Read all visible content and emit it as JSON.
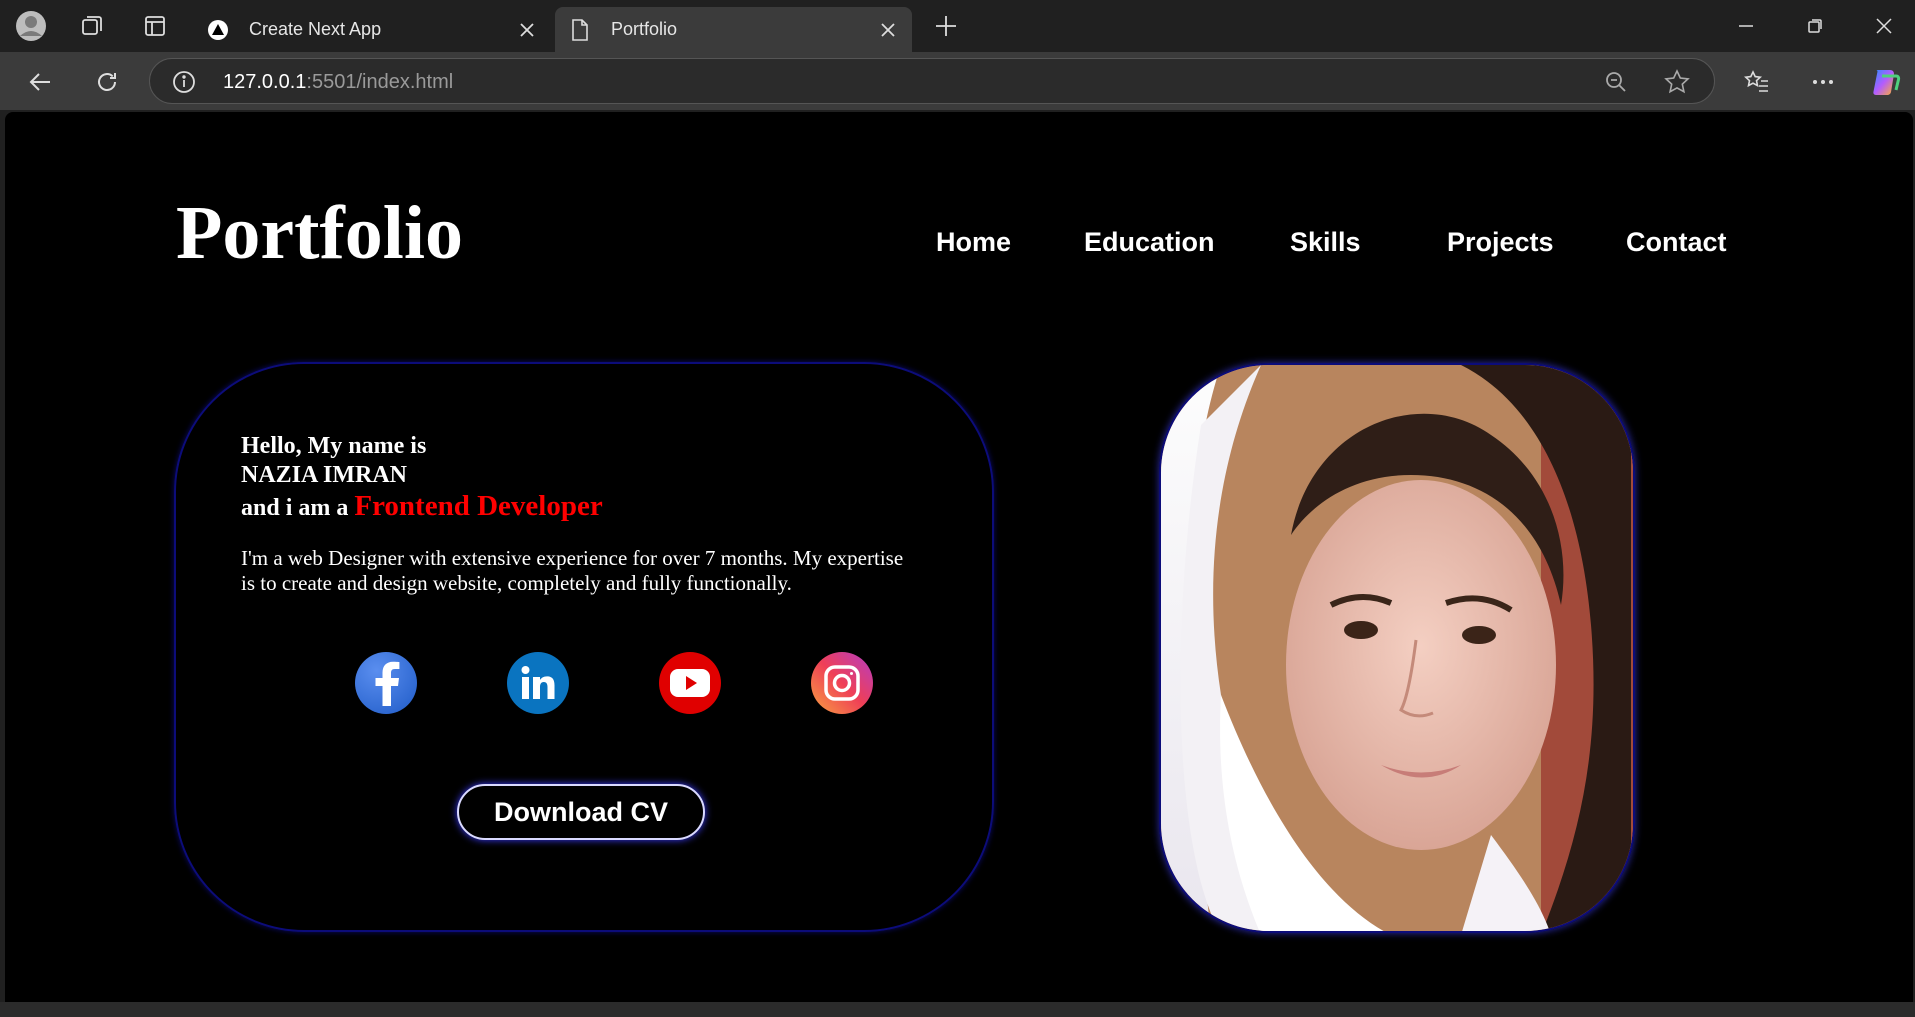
{
  "browser": {
    "tabs": [
      {
        "title": "Create Next App",
        "icon": "nextjs-triangle-icon",
        "active": false
      },
      {
        "title": "Portfolio",
        "icon": "document-icon",
        "active": true
      }
    ],
    "url_host": "127.0.0.1",
    "url_rest": ":5501/index.html"
  },
  "site": {
    "logo": "Portfolio",
    "nav": [
      "Home",
      "Education",
      "Skills",
      "Projects",
      "Contact"
    ]
  },
  "hero": {
    "greeting": "Hello, My name is",
    "name": "NAZIA IMRAN",
    "role_prefix": "and i am a",
    "role": "Frontend Developer",
    "description": "I'm a web Designer with extensive experience for over 7 months. My expertise is to create and design website, completely and fully functionally.",
    "social": [
      "facebook-icon",
      "linkedin-icon",
      "youtube-icon",
      "instagram-icon"
    ],
    "cv_button": "Download CV"
  },
  "colors": {
    "accent_red": "#ff0000",
    "border_blue": "#0c0c7a",
    "page_bg": "#000000"
  }
}
